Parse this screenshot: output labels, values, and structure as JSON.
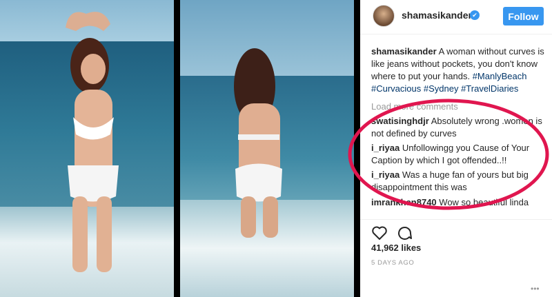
{
  "post": {
    "username": "shamasikander",
    "follow_label": "Follow",
    "verified_icon": "✔",
    "caption": {
      "user": "shamasikander",
      "text": " A woman without curves is like jeans without pockets, you don't know where to put your hands. ",
      "tags": "#ManlyBeach #Curvacious #Sydney #TravelDiaries"
    },
    "load_more": "Load more comments",
    "comments": [
      {
        "user": "swatisinghdjr",
        "text": " Absolutely wrong .women is not defined by curves"
      },
      {
        "user": "i_riyaa",
        "text": " Unfollowingg you Cause of Your Caption by which I got offended..!!"
      },
      {
        "user": "i_riyaa",
        "text": " Was a huge fan of yours but big disappointment this was"
      },
      {
        "user": "imrankhan8740",
        "text": " Wow so beautiful linda demais excellent beauty love your bikini"
      }
    ],
    "likes": "41,962 likes",
    "timestamp": "5 DAYS AGO",
    "more_icon": "•••"
  },
  "colors": {
    "accent": "#3897f0",
    "highlight": "#e0164f"
  }
}
